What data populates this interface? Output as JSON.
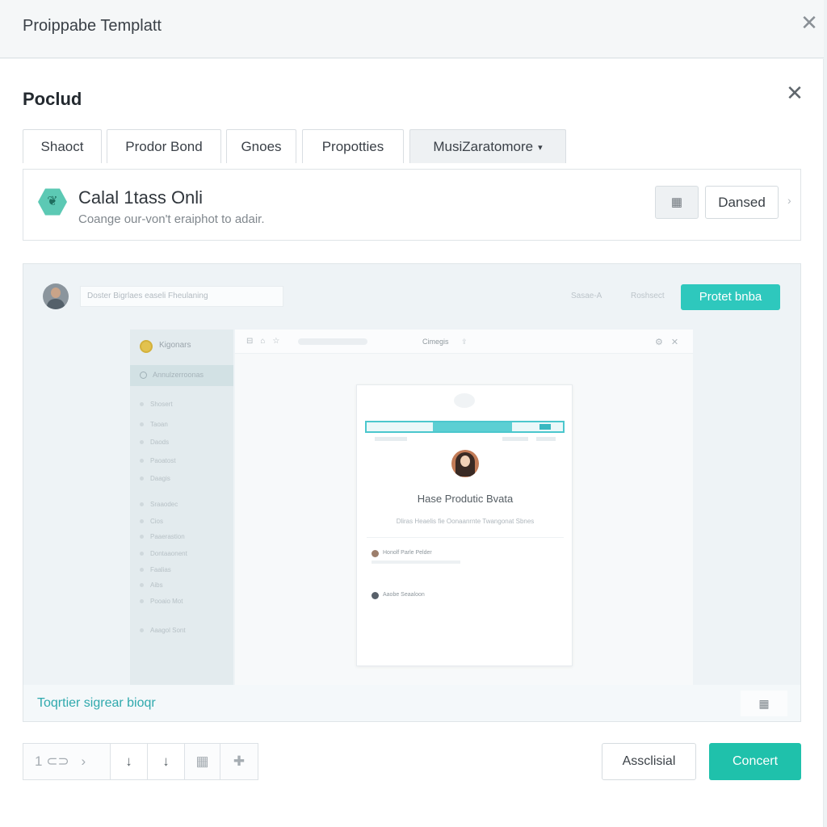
{
  "window": {
    "title": "Proippabe Templatt",
    "close_icon": "close-icon"
  },
  "panel": {
    "title": "Poclud",
    "close_icon": "close-icon"
  },
  "tabs": [
    {
      "label": "Shaoct"
    },
    {
      "label": "Prodor Bond"
    },
    {
      "label": "Gnoes"
    },
    {
      "label": "Propotties"
    },
    {
      "label": "MusiZaratomore",
      "dropdown": true,
      "active": true
    }
  ],
  "info_card": {
    "icon": "leaf-icon",
    "title": "Calal 1tass Onli",
    "subtitle": "Coange our-von't eraiphot to adair.",
    "icon_button": "image-icon",
    "button_label": "Dansed"
  },
  "preview": {
    "search_placeholder": "Doster Bigrlaes easeli Fheulaning",
    "link_1": "Sasae-A",
    "link_2": "Roshsect",
    "primary_button": "Protet bnba",
    "sidebar": {
      "brand": "Kigonars",
      "active_item": "Annulzerroonas",
      "items": [
        "Shosert",
        "Taoan",
        "Daods",
        "Paoatost",
        "Daagis",
        "Sraaodec",
        "Cios",
        "Paaerastion",
        "Dontaaonent",
        "Faalias",
        "Aibs",
        "Pooaio Mot",
        "Aaagol Sont"
      ]
    },
    "browser": {
      "tab_name": "Cimegis",
      "card_title": "Hase Produtic Bvata",
      "card_description": "Dliras Heaelis fie Oonaanrnte Twangonat Sbnes",
      "items": [
        "Honolf Parle Pelder",
        "Aaobe Seaaloon"
      ]
    },
    "footer_link": "Toqrtier sigrear bioqr",
    "footer_icon": "image-icon"
  },
  "toolbar": {
    "page": "1",
    "items": [
      "1",
      "toggle-icon",
      "chevron-right-icon",
      "arrow-down-icon",
      "arrow-down-icon",
      "image-icon",
      "plus-icon"
    ]
  },
  "actions": {
    "secondary_label": "Assclisial",
    "primary_label": "Concert"
  },
  "colors": {
    "accent": "#1fc1ab",
    "preview_accent": "#2ec8bd",
    "link": "#2fa9ad"
  }
}
